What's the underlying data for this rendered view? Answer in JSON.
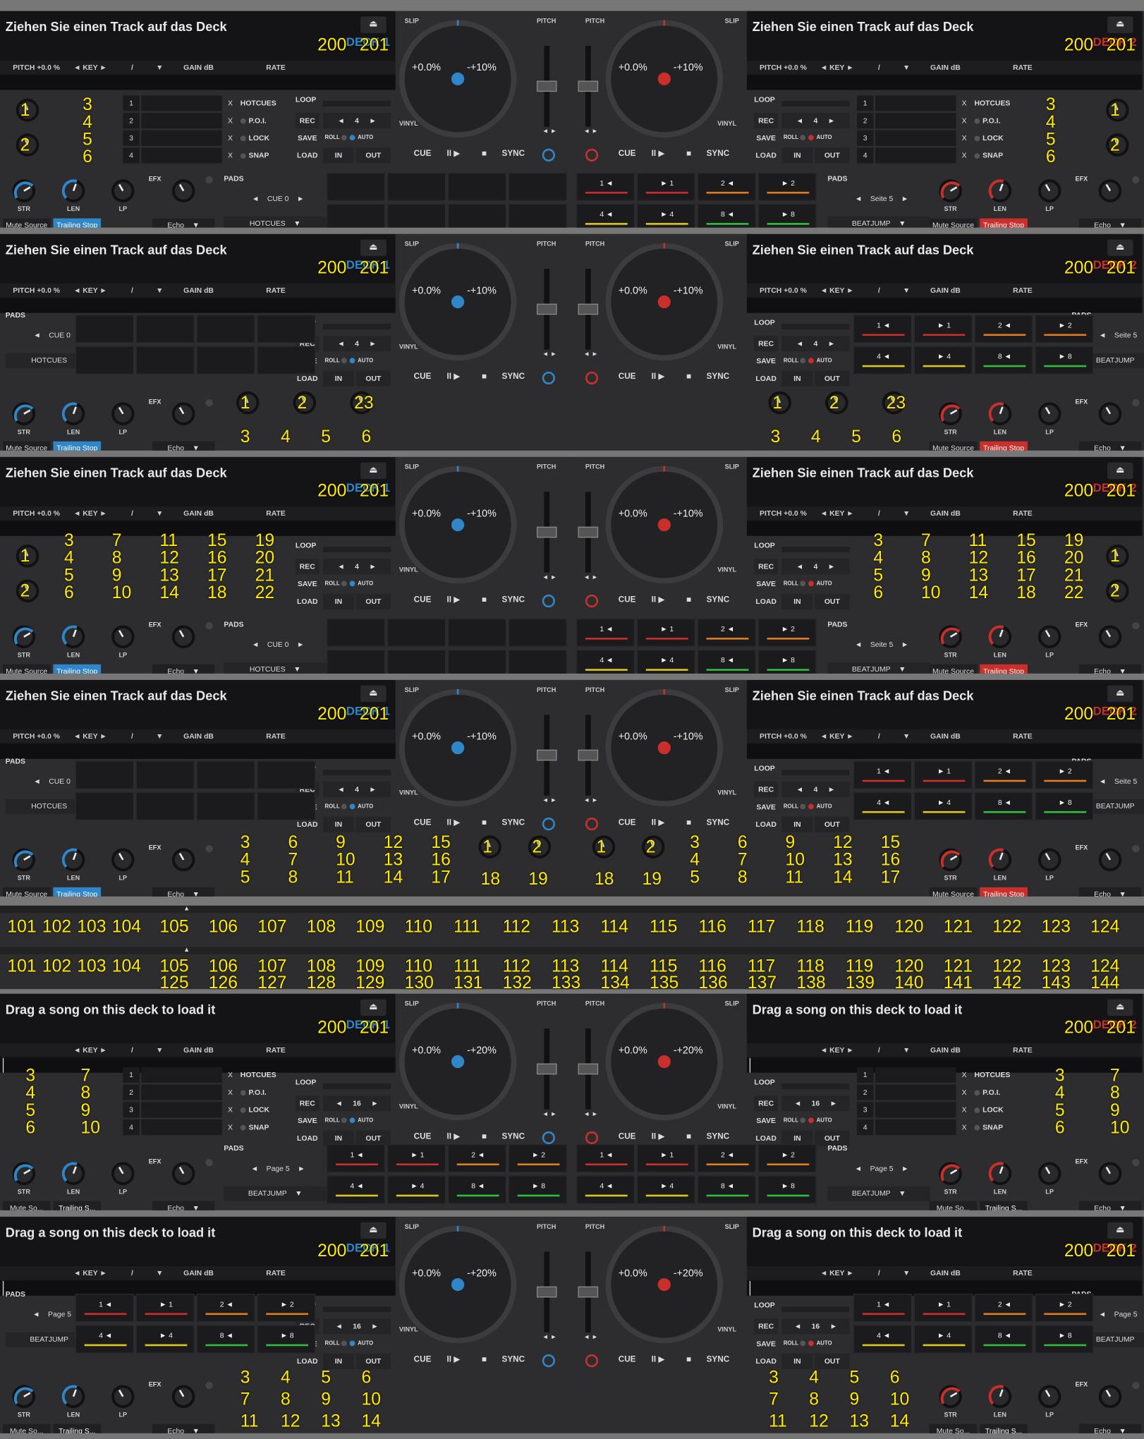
{
  "labels": {
    "title_de": "Ziehen Sie einen Track auf das Deck",
    "title_en": "Drag a song on this deck to load it",
    "deck1": "DECK 1",
    "deck2": "DECK 2",
    "pitch": "PITCH +0.0 %",
    "key": "◄ KEY ►",
    "slash": "/",
    "gain": "GAIN dB",
    "rate": "RATE",
    "v200": "200",
    "v201": "201",
    "hotcues": "HOTCUES",
    "loop": "LOOP",
    "rec": "REC",
    "save": "SAVE",
    "load": "LOAD",
    "in": "IN",
    "out": "OUT",
    "roll": "ROLL",
    "auto": "AUTO",
    "poi": "P.O.I.",
    "lock": "LOCK",
    "snap": "SNAP",
    "x": "X",
    "pads": "PADS",
    "cue0": "CUE 0",
    "seite": "Seite 5",
    "page": "Page 5",
    "beatjump": "BEATJUMP",
    "efx": "EFX",
    "str": "STR",
    "len": "LEN",
    "lp": "LP",
    "mute": "Mute Source",
    "mute_s": "Mute So...",
    "trail": "Trailing Stop",
    "trail_s": "Trailing S...",
    "echo": "Echo",
    "slip": "SLIP",
    "vinyl": "VINYL",
    "pitchlbl": "PITCH",
    "cue": "CUE",
    "sync": "SYNC",
    "p0": "+0.0%",
    "p10": "-+10%",
    "p20": "-+20%",
    "loop4": "4",
    "loop16": "16",
    "play": "II ▶",
    "stop": "■"
  },
  "pads": [
    "1 ◄",
    "► 1",
    "2 ◄",
    "► 2",
    "4 ◄",
    "► 4",
    "8 ◄",
    "► 8"
  ],
  "padcolors": [
    "#c9302c",
    "#c9302c",
    "#e07b20",
    "#e07b20",
    "#d9c81f",
    "#d9c81f",
    "#2fbf3f",
    "#2fbf3f"
  ],
  "strip_nums": [
    "101",
    "102",
    "103",
    "104",
    "105",
    "106",
    "107",
    "108",
    "109",
    "110",
    "111",
    "112",
    "113",
    "114",
    "115",
    "116",
    "117",
    "118",
    "119",
    "120",
    "121",
    "122",
    "123",
    "124"
  ],
  "strip_nums2": [
    "125",
    "126",
    "127",
    "128",
    "129",
    "130",
    "131",
    "132",
    "133",
    "134",
    "135",
    "136",
    "137",
    "138",
    "139",
    "140",
    "141",
    "142",
    "143",
    "144"
  ],
  "colors": {
    "deck1": "#2f86c8",
    "deck2": "#c9302c",
    "mark": "#ffeb00"
  }
}
